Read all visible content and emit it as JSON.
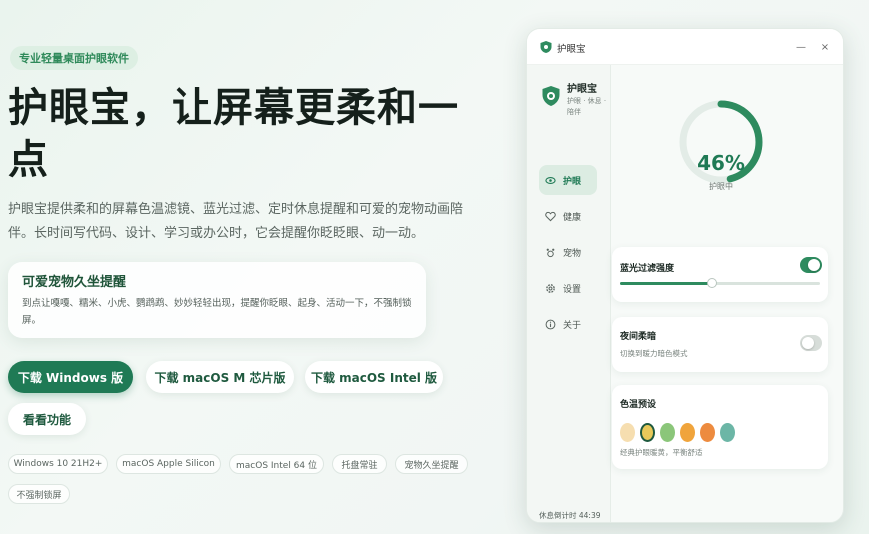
{
  "hero": {
    "tag": "专业轻量桌面护眼软件",
    "headline": "护眼宝，让屏幕更柔和一点",
    "description": "护眼宝提供柔和的屏幕色温滤镜、蓝光过滤、定时休息提醒和可爱的宠物动画陪伴。长时间写代码、设计、学习或办公时，它会提醒你眨眨眼、动一动。",
    "feature_card": {
      "title": "可爱宠物久坐提醒",
      "text": "到点让嘎嘎、糯米、小虎、鹦鹉鹉、妙妙轻轻出现，提醒你眨眼、起身、活动一下，不强制锁屏。"
    },
    "buttons": {
      "download_windows": "下载 Windows 版",
      "download_mac_m": "下载 macOS M 芯片版",
      "download_mac_intel": "下载 macOS Intel 版",
      "view_features": "看看功能"
    },
    "chips": [
      "Windows 10 21H2+",
      "macOS Apple Silicon",
      "macOS Intel 64 位",
      "托盘常驻",
      "宠物久坐提醒",
      "不强制锁屏"
    ]
  },
  "app_window": {
    "title": "护眼宝",
    "controls": {
      "minimize": "—",
      "maximize": "□",
      "close": "×"
    },
    "brand": {
      "name": "护眼宝",
      "subtitle": "护眼 · 休息 · 陪伴"
    },
    "nav": [
      {
        "label": "护眼",
        "icon": "eye-icon",
        "active": true
      },
      {
        "label": "健康",
        "icon": "heart-icon",
        "active": false
      },
      {
        "label": "宠物",
        "icon": "pet-icon",
        "active": false
      },
      {
        "label": "设置",
        "icon": "gear-icon",
        "active": false
      },
      {
        "label": "关于",
        "icon": "info-icon",
        "active": false
      }
    ],
    "break_timer": "休息倒计时 44:39",
    "status_ring": {
      "value_text": "46%",
      "value": 0.46,
      "label": "护眼中"
    },
    "blue_light": {
      "title": "蓝光过滤强度",
      "enabled": true,
      "level": 0.46
    },
    "night_mode": {
      "title": "夜间柔暗",
      "subtitle": "切换到暖力暗色模式",
      "enabled": false
    },
    "color_temp": {
      "title": "色温预设",
      "subtitle": "经典护眼暖黄，平衡舒适",
      "swatches": [
        "#f6deb0",
        "#e8c95a",
        "#8bc67a",
        "#f0a43c",
        "#ed8b3f",
        "#6cb6a6"
      ],
      "selected_index": 1
    }
  },
  "colors": {
    "accent": "#1f7a55",
    "accent_light": "#2e8b5f",
    "toggle_off": "#d7ddd9"
  }
}
